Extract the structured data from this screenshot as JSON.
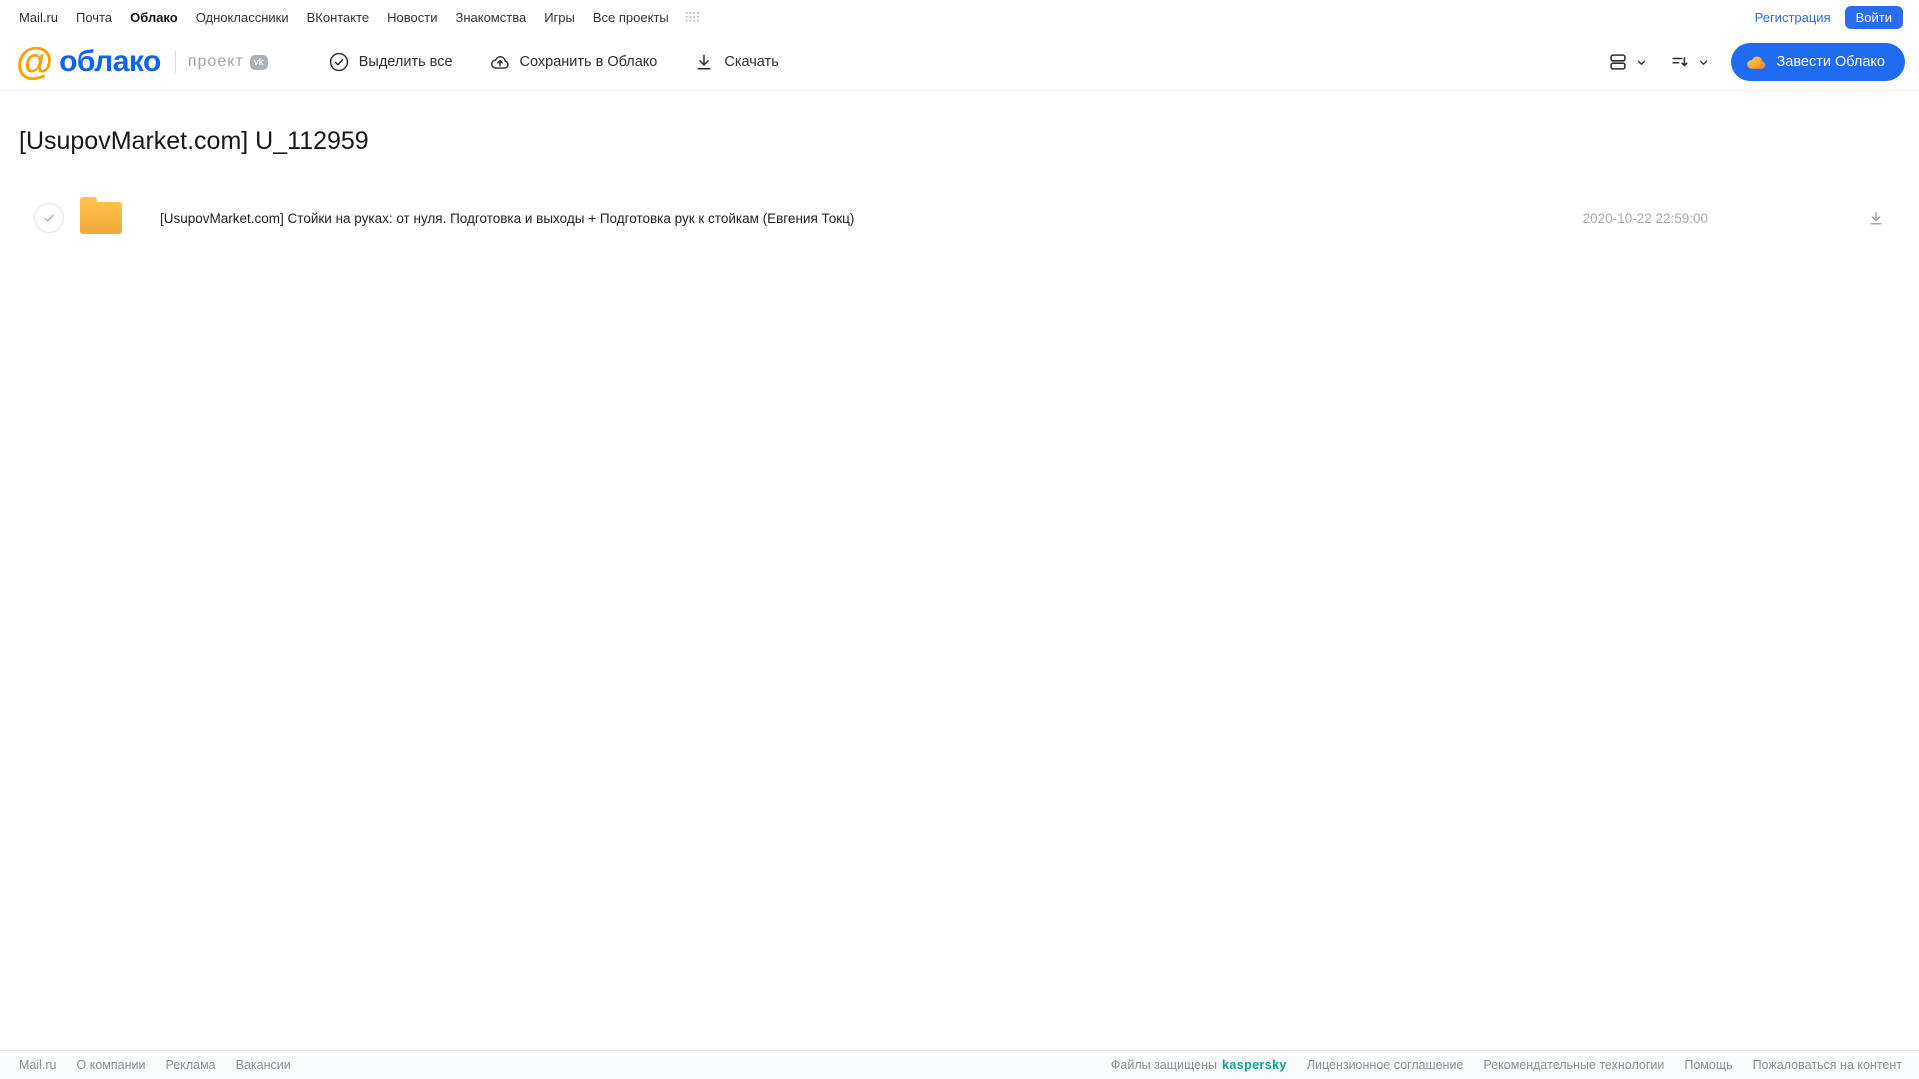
{
  "top_nav": {
    "links": [
      "Mail.ru",
      "Почта",
      "Облако",
      "Одноклассники",
      "ВКонтакте",
      "Новости",
      "Знакомства",
      "Игры",
      "Все проекты"
    ],
    "active_link": "Облако",
    "registration_label": "Регистрация",
    "login_label": "Войти"
  },
  "header": {
    "logo_at": "@",
    "logo_text": "облако",
    "project_label": "проект",
    "vk_badge_label": "vk",
    "toolbar": {
      "select_all_label": "Выделить все",
      "save_to_cloud_label": "Сохранить в Облако",
      "download_label": "Скачать"
    },
    "create_cloud_label": "Завести Облако"
  },
  "main": {
    "title": "[UsupovMarket.com] U_112959",
    "files": [
      {
        "type": "folder",
        "name": "[UsupovMarket.com] Стойки на руках: от нуля. Подготовка и выходы + Подготовка рук к стойкам (Евгения Токц)",
        "date": "2020-10-22 22:59:00"
      }
    ]
  },
  "footer": {
    "left_links": [
      "Mail.ru",
      "О компании",
      "Реклама",
      "Вакансии"
    ],
    "protected_text": "Файлы защищены",
    "kaspersky_label": "kaspersky",
    "right_links": [
      "Лицензионное соглашение",
      "Рекомендательные технологии",
      "Помощь",
      "Пожаловаться на контент"
    ]
  },
  "colors": {
    "accent_blue": "#1f6bf2",
    "logo_orange": "#ffa000",
    "kaspersky_teal": "#00a88e",
    "folder_yellow": "#f5ab38"
  }
}
